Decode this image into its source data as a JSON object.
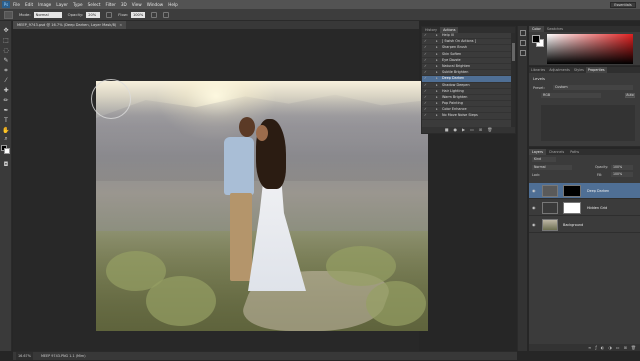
{
  "app": {
    "logo": "Ps",
    "workspace": "Essentials"
  },
  "menu": [
    "File",
    "Edit",
    "Image",
    "Layer",
    "Type",
    "Select",
    "Filter",
    "3D",
    "View",
    "Window",
    "Help"
  ],
  "options": {
    "mode_label": "Mode:",
    "mode_value": "Normal",
    "opacity_label": "Opacity:",
    "opacity_value": "20%",
    "flow_label": "Flow:",
    "flow_value": "100%"
  },
  "document": {
    "tab_label": "MEEP_9743.psd @ 16.7% (Deep Darken, Layer Mask/8)",
    "close_glyph": "×"
  },
  "actions_panel": {
    "tabs": [
      "History",
      "Actions"
    ],
    "active_tab": "Actions",
    "items": [
      "Help III",
      "[ Swish On Actions ]",
      "Sharpen Brush",
      "Skin Soften",
      "Eye Dazzle",
      "Natural Brighten",
      "Subtle Brighten",
      "Deep Darken",
      "Shadow Deepen",
      "Hair Lighting",
      "Warm Brighten",
      "Pop Painting",
      "Color Enhance",
      "No Move Noise Steps"
    ],
    "selected_item": "Deep Darken"
  },
  "color_panel": {
    "tabs": [
      "Color",
      "Swatches"
    ],
    "active_tab": "Color"
  },
  "properties_panel": {
    "tabs": [
      "Libraries",
      "Adjustments",
      "Styles",
      "Properties"
    ],
    "active_tab": "Properties",
    "title": "Levels",
    "preset_label": "Preset:",
    "preset_value": "Custom",
    "channel_value": "RGB",
    "auto_label": "Auto"
  },
  "layers_panel": {
    "tabs": [
      "Layers",
      "Channels",
      "Paths"
    ],
    "active_tab": "Layers",
    "kind_value": "Kind",
    "blend_value": "Normal",
    "opacity_label": "Opacity:",
    "opacity_value": "100%",
    "lock_label": "Lock:",
    "fill_label": "Fill:",
    "fill_value": "100%",
    "layers": [
      {
        "name": "Deep Darken",
        "selected": true
      },
      {
        "name": "Hidden Grid",
        "selected": false
      },
      {
        "name": "Background",
        "selected": false
      }
    ]
  },
  "status": {
    "zoom": "16.67%",
    "doc": "MEEP 9743.PNG 1.1 (Mim)"
  },
  "colors": {
    "selection": "#4f6f95",
    "chrome": "#535353",
    "panel": "#3b3b3b"
  }
}
